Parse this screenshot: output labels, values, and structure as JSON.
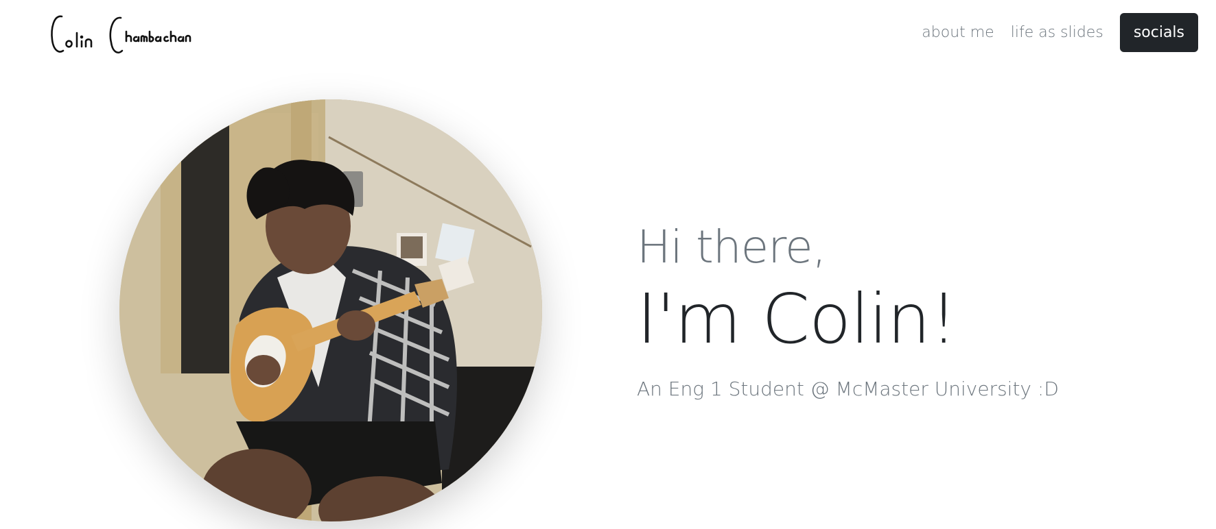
{
  "nav": {
    "brand": "Colin Chambachan",
    "links": [
      {
        "label": "about me"
      },
      {
        "label": "life as slides"
      }
    ],
    "cta_label": "socials"
  },
  "hero": {
    "greeting": "Hi there,",
    "name": "I'm Colin!",
    "tagline": "An Eng 1 Student @ McMaster University :D",
    "photo_alt": "Colin playing an electric guitar"
  },
  "colors": {
    "dark": "#212529",
    "muted": "#6c757d",
    "background": "#ffffff"
  }
}
